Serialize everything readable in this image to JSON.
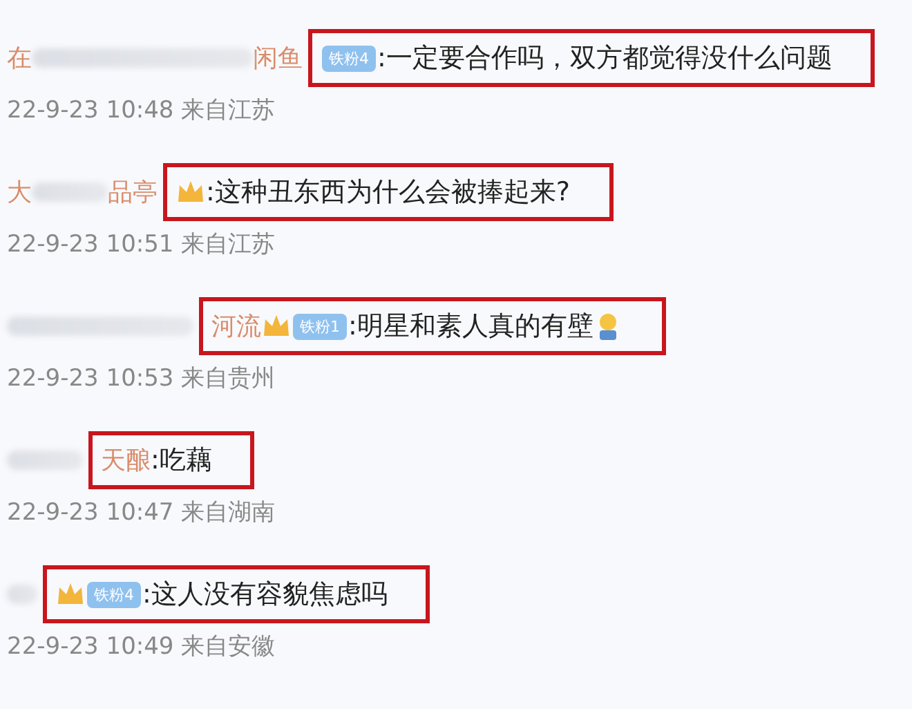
{
  "comments": [
    {
      "name": [
        {
          "kind": "text",
          "text": "在"
        },
        {
          "kind": "blur-long"
        },
        {
          "kind": "text",
          "text": "闲鱼"
        }
      ],
      "badges": [
        {
          "kind": "fan",
          "text": "铁粉4"
        }
      ],
      "text": ":一定要合作吗，双方都觉得没什么问题",
      "emoji": false,
      "time": "22-9-23 10:48 来自江苏"
    },
    {
      "name": [
        {
          "kind": "text",
          "text": "大"
        },
        {
          "kind": "blur-short"
        },
        {
          "kind": "text",
          "text": "品亭"
        }
      ],
      "badges": [
        {
          "kind": "crown"
        }
      ],
      "text": ":这种丑东西为什么会被捧起来?",
      "emoji": false,
      "time": "22-9-23 10:51 来自江苏"
    },
    {
      "name": [
        {
          "kind": "blur-mid"
        }
      ],
      "framed_name": [
        {
          "kind": "text",
          "text": "河流"
        }
      ],
      "badges": [
        {
          "kind": "crown"
        },
        {
          "kind": "fan",
          "text": "铁粉1"
        }
      ],
      "text": ":明星和素人真的有壁",
      "emoji": true,
      "time": "22-9-23 10:53 来自贵州"
    },
    {
      "name": [
        {
          "kind": "blur-short"
        }
      ],
      "framed_name": [
        {
          "kind": "text",
          "text": "天酿"
        }
      ],
      "text": ":吃藕",
      "emoji": false,
      "time": "22-9-23 10:47 来自湖南"
    },
    {
      "name": [
        {
          "kind": "blur-tiny"
        }
      ],
      "badges": [
        {
          "kind": "crown"
        },
        {
          "kind": "fan",
          "text": "铁粉4"
        }
      ],
      "text": ":这人没有容貌焦虑吗",
      "emoji": false,
      "time": "22-9-23 10:49 来自安徽"
    }
  ]
}
